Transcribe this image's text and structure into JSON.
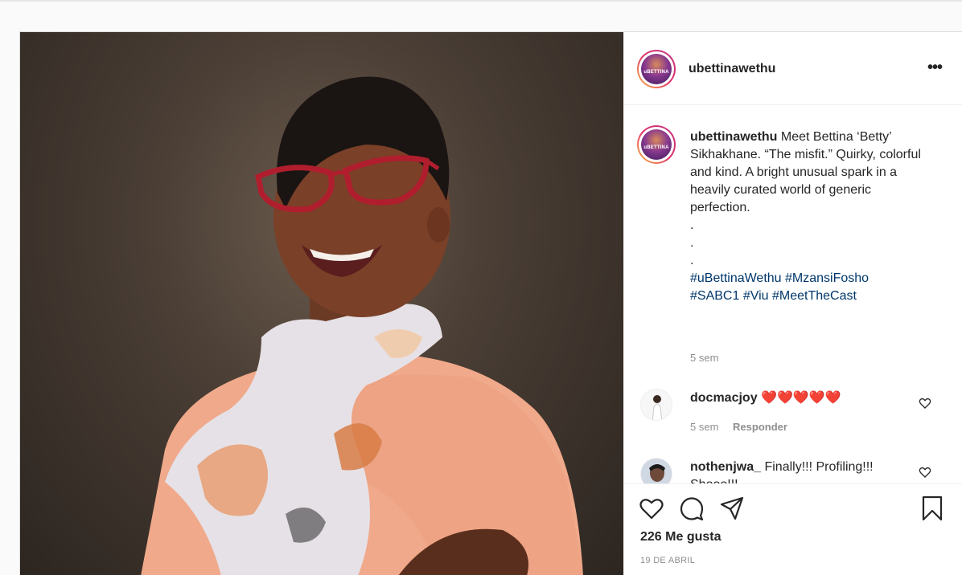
{
  "post": {
    "username": "ubettinawethu",
    "avatar_label": "uBETTINA",
    "caption": {
      "author": "ubettinawethu",
      "text": "Meet Bettina ‘Betty’ Sikhakhane. “The misfit.” Quirky, colorful and kind. A bright unusual spark in a heavily curated world of generic perfection.",
      "dot1": ".",
      "dot2": ".",
      "dot3": ".",
      "hashtags": [
        "#uBettinaWethu",
        "#MzansiFosho",
        "#SABC1",
        "#Viu",
        "#MeetTheCast"
      ],
      "time": "5 sem"
    },
    "comments": [
      {
        "username": "docmacjoy",
        "text": "",
        "hearts": "❤️❤️❤️❤️❤️",
        "time": "5 sem",
        "reply_label": "Responder"
      },
      {
        "username": "nothenjwa_",
        "text": "Finally!!! Profiling!!! Shooo!!!"
      }
    ],
    "likes": "226 Me gusta",
    "date": "19 DE ABRIL",
    "more_options": "•••"
  },
  "icons": {
    "like": "heart-outline-icon",
    "comment": "comment-bubble-icon",
    "share": "paper-plane-icon",
    "save": "bookmark-icon",
    "comment_like": "small-heart-icon"
  },
  "colors": {
    "hashtag": "#00376b",
    "meta_gray": "#8e8e8e",
    "heart_red": "#e0245e",
    "border": "#dbdbdb"
  }
}
